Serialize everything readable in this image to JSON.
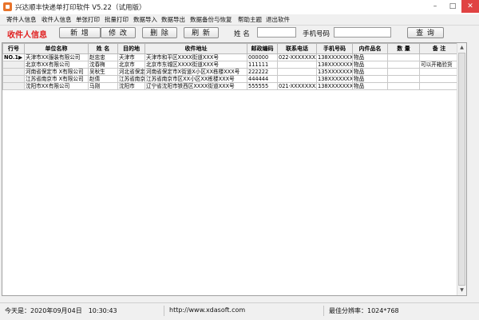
{
  "window": {
    "title": "兴达顺丰快递单打印软件 V5.22（试用版）",
    "minimize_glyph": "–",
    "maximize_glyph": "□",
    "close_glyph": "✕"
  },
  "menu": [
    "寄件人信息",
    "收件人信息",
    "单张打印",
    "批量打印",
    "数据导入",
    "数据导出",
    "数据备份与恢复",
    "帮助主题",
    "退出软件"
  ],
  "toolbar": {
    "section_label": "收件人信息",
    "add_label": "新 增",
    "edit_label": "修 改",
    "delete_label": "删 除",
    "refresh_label": "刷 新",
    "name_label": "姓 名",
    "name_value": "",
    "phone_label": "手机号码",
    "phone_value": "",
    "search_label": "查 询"
  },
  "grid": {
    "columns": [
      "行号",
      "单位名称",
      "姓 名",
      "目的地",
      "收件地址",
      "邮政编码",
      "联系电话",
      "手机号码",
      "内件品名",
      "数 量",
      "备 注"
    ],
    "rows": [
      {
        "num": "NO.1",
        "marker": "▶",
        "company": "天津市XX服装有限公司",
        "name": "赵忠忠",
        "dest": "天津市",
        "address": "天津市和平区XXXX街道XXX号",
        "zip": "000000",
        "tel": "022-XXXXXXXX",
        "mobile": "138XXXXXXX0",
        "item": "物品",
        "qty": "",
        "note": ""
      },
      {
        "num": "",
        "marker": "",
        "company": "北京市XX有限公司",
        "name": "沈春梅",
        "dest": "北京市",
        "address": "北京市东城区XXXX街道XXX号",
        "zip": "111111",
        "tel": "",
        "mobile": "138XXXXXXX1",
        "item": "物品",
        "qty": "",
        "note": "可以开箱验货"
      },
      {
        "num": "",
        "marker": "",
        "company": "河南省保定市 X有限公司",
        "name": "吴秋生",
        "dest": "河北省保定",
        "address": "河南省保定市X街道X小区XX栋楼XXX号",
        "zip": "222222",
        "tel": "",
        "mobile": "135XXXXXXX0",
        "item": "物品",
        "qty": "",
        "note": ""
      },
      {
        "num": "",
        "marker": "",
        "company": "江苏省南京市 X有限公司",
        "name": "赵倩",
        "dest": "江苏省南京",
        "address": "江苏省南京市区XX小区XX栋楼XXX号",
        "zip": "444444",
        "tel": "",
        "mobile": "138XXXXXXX0",
        "item": "物品",
        "qty": "",
        "note": ""
      },
      {
        "num": "",
        "marker": "",
        "company": "沈阳市XX有限公司",
        "name": "马刚",
        "dest": "沈阳市",
        "address": "辽宁省沈阳市铁西区XXXX街道XXX号",
        "zip": "555555",
        "tel": "021-XXXXXXXX",
        "mobile": "138XXXXXXX0",
        "item": "物品",
        "qty": "",
        "note": ""
      }
    ]
  },
  "status": {
    "date": "今天是：2020年09月04日　10:30:43",
    "url": "http://www.xdasoft.com",
    "resolution": "最佳分辨率：1024*768"
  }
}
